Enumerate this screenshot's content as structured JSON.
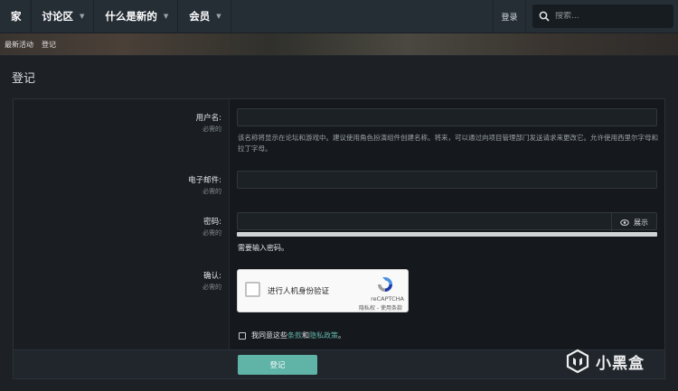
{
  "nav": {
    "home": "家",
    "forums": "讨论区",
    "whats_new": "什么是新的",
    "members": "会员",
    "login": "登录",
    "search_placeholder": "搜索..."
  },
  "breadcrumb": {
    "latest_activity": "最新活动",
    "register": "登记"
  },
  "page_title": "登记",
  "form": {
    "username": {
      "label": "用户名:",
      "required": "必需的",
      "hint": "该名称将显示在论坛和游戏中。建议使用角色扮演组件创建名称。将来，可以通过向项目管理部门发送请求来更改它。允许使用西里尔字母和拉丁字母。"
    },
    "email": {
      "label": "电子邮件:",
      "required": "必需的"
    },
    "password": {
      "label": "密码:",
      "required": "必需的",
      "show_label": "展示",
      "note": "需要输入密码。"
    },
    "confirm": {
      "label": "确认:",
      "required": "必需的",
      "recaptcha_text": "进行人机身份验证",
      "recaptcha_brand": "reCAPTCHA",
      "recaptcha_links": "隐私权 - 使用条款"
    },
    "agree": {
      "prefix": "我同意这些",
      "terms_link": "条款",
      "and": "和",
      "privacy_link": "隐私政策",
      "suffix": "。"
    },
    "submit_label": "登记"
  },
  "watermark": {
    "text": "小黑盒"
  },
  "colors": {
    "accent": "#5fb3a7",
    "nav_bg": "#252d35",
    "page_bg": "#1d2126"
  }
}
